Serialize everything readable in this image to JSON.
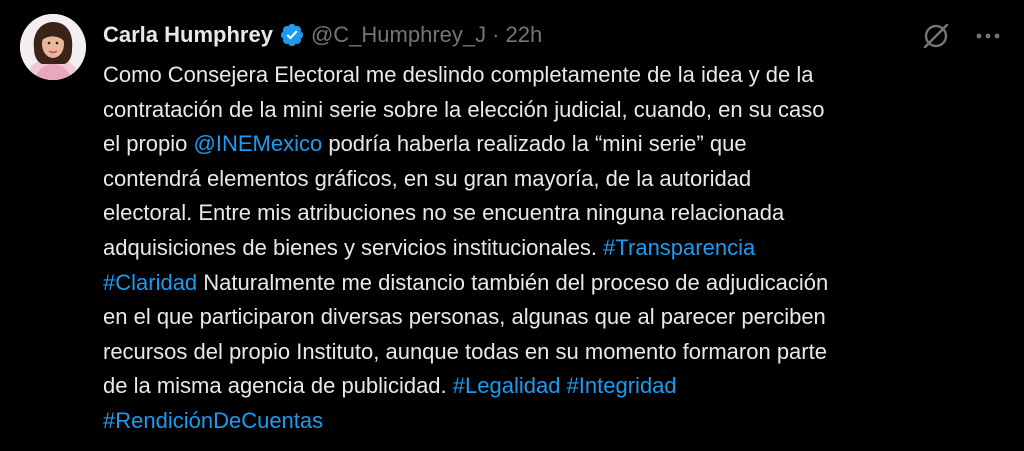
{
  "tweet": {
    "author_name": "Carla Humphrey",
    "handle": "@C_Humphrey_J",
    "separator": "·",
    "timestamp": "22h",
    "verified": true,
    "lines": [
      [
        {
          "text": "Como Consejera Electoral me deslindo completamente de la idea y de la",
          "type": "text"
        }
      ],
      [
        {
          "text": "contratación de la mini serie sobre la elección judicial, cuando, en su caso",
          "type": "text"
        }
      ],
      [
        {
          "text": "el propio ",
          "type": "text"
        },
        {
          "text": "@INEMexico",
          "type": "mention"
        },
        {
          "text": " podría haberla realizado la “mini serie” que",
          "type": "text"
        }
      ],
      [
        {
          "text": "contendrá elementos gráficos, en su gran mayoría, de la autoridad",
          "type": "text"
        }
      ],
      [
        {
          "text": "electoral. Entre mis atribuciones no se encuentra ninguna relacionada",
          "type": "text"
        }
      ],
      [
        {
          "text": "adquisiciones de bienes y servicios institucionales. ",
          "type": "text"
        },
        {
          "text": "#Transparencia",
          "type": "hashtag"
        }
      ],
      [
        {
          "text": "#Claridad",
          "type": "hashtag"
        },
        {
          "text": " Naturalmente me distancio también del proceso de adjudicación",
          "type": "text"
        }
      ],
      [
        {
          "text": "en el que participaron diversas personas, algunas que al parecer perciben",
          "type": "text"
        }
      ],
      [
        {
          "text": "recursos del propio Instituto, aunque todas en su momento formaron parte",
          "type": "text"
        }
      ],
      [
        {
          "text": "de la misma agencia de publicidad. ",
          "type": "text"
        },
        {
          "text": "#Legalidad",
          "type": "hashtag"
        },
        {
          "text": " ",
          "type": "text"
        },
        {
          "text": "#Integridad",
          "type": "hashtag"
        }
      ],
      [
        {
          "text": "#RendiciónDeCuentas",
          "type": "hashtag"
        }
      ]
    ]
  },
  "icons": {
    "verified": "verified-badge-icon",
    "grok": "grok-icon",
    "more": "more-options-icon"
  },
  "colors": {
    "background": "#000000",
    "text": "#e7e9ea",
    "secondary": "#71767b",
    "link": "#1d9bf0"
  }
}
